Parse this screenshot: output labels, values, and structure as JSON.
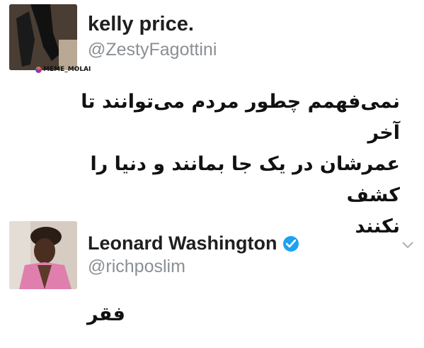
{
  "tweets": [
    {
      "display_name": "kelly price.",
      "handle": "@ZestyFagottini",
      "text": "نمی‌فهمم چطور مردم می‌توانند تا آخر\nعمرشان در یک جا بمانند و دنیا را کشف\nنکنند",
      "avatar_icon": "profile-photo-boots"
    },
    {
      "display_name": "Leonard Washington",
      "handle": "@richposlim",
      "text": "فقر",
      "verified": true,
      "avatar_icon": "profile-photo-man-pink-jacket",
      "menu_icon": "chevron-down-icon"
    }
  ],
  "watermark": "MEME_MOLAI",
  "colors": {
    "verified_blue": "#1da1f2",
    "handle_gray": "#8a8f94"
  }
}
